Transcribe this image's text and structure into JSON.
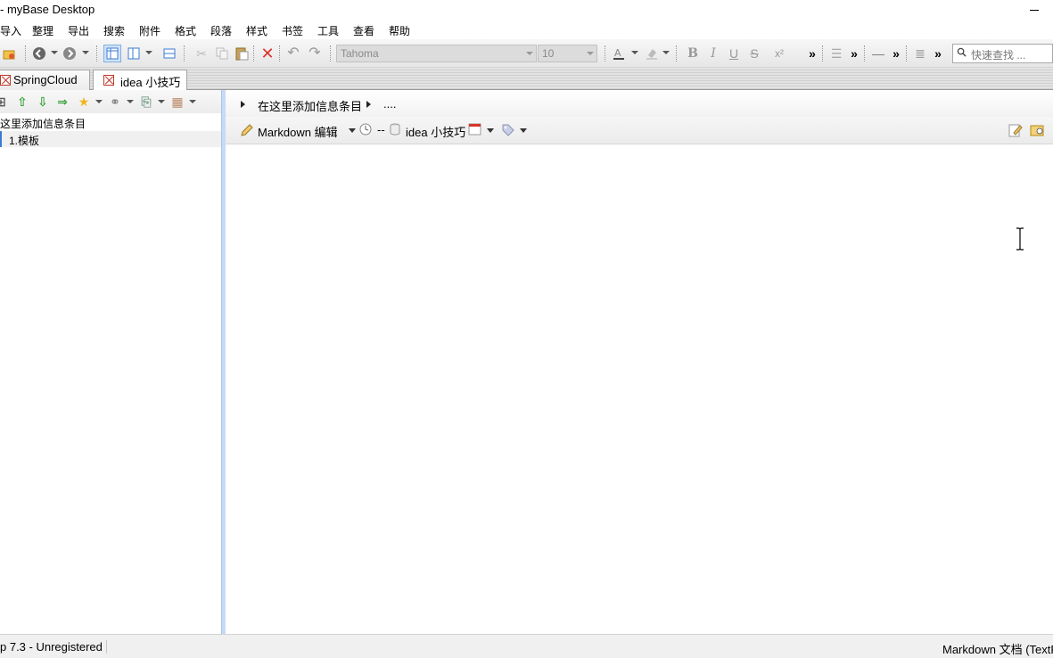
{
  "window": {
    "title": "- myBase Desktop"
  },
  "menu": [
    "导入",
    "整理",
    "导出",
    "搜索",
    "附件",
    "格式",
    "段落",
    "样式",
    "书签",
    "工具",
    "查看",
    "帮助"
  ],
  "toolbar": {
    "font_name": "Tahoma",
    "font_size": "10",
    "bold_label": "B",
    "italic_label": "I",
    "underline_label": "U",
    "strike_label": "S",
    "super_label": "x²",
    "more1": "»",
    "more2": "»",
    "more3": "»",
    "more4": "»",
    "search_placeholder": "快速查找 ..."
  },
  "tabs": [
    {
      "label": "SpringCloud"
    },
    {
      "label": "idea 小技巧"
    }
  ],
  "tree": {
    "header": "这里添加信息条目",
    "items": [
      "1.模板"
    ]
  },
  "content": {
    "breadcrumb": "在这里添加信息条目",
    "breadcrumb_more": "....",
    "editor_mode": "Markdown 编辑",
    "time_dash": "--",
    "doc_title": "idea 小技巧"
  },
  "status": {
    "left": "p 7.3 - Unregistered",
    "right": "Markdown 文档 (TextF"
  },
  "colors": {
    "accent": "#3b7bd6",
    "splitter": "#c8daf5",
    "close_red": "#d9342b",
    "green_arrow": "#3aa13a"
  }
}
